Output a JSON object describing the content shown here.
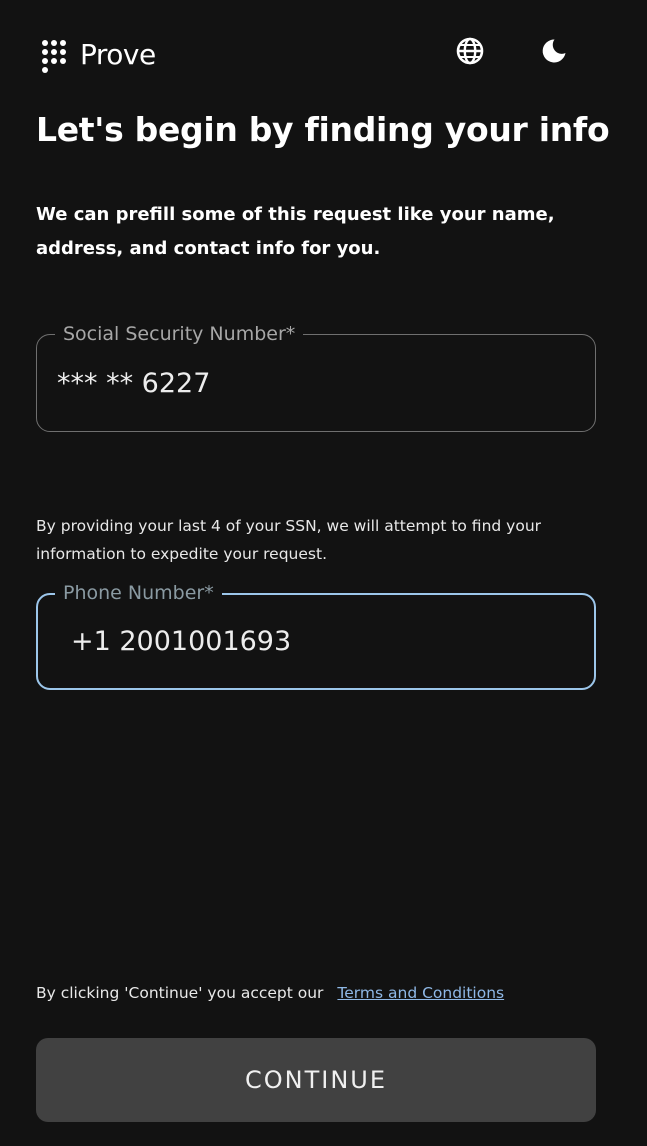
{
  "header": {
    "brand": "Prove",
    "logo_icon": "prove-dot-grid-logo",
    "language_icon": "globe-icon",
    "theme_icon": "moon-icon"
  },
  "main": {
    "title": "Let's begin by finding your info",
    "intro": "We can prefill some of this request like your name, address, and contact info for you.",
    "ssn": {
      "label": "Social Security Number*",
      "value": "*** ** 6227"
    },
    "helper": "By providing your last 4 of your SSN, we will attempt to find your information to expedite your request.",
    "phone": {
      "label": "Phone Number*",
      "value": "+1 2001001693"
    }
  },
  "footer": {
    "terms_prefix": "By clicking 'Continue' you accept our",
    "terms_link": "Terms and Conditions",
    "continue_label": "CONTINUE"
  },
  "colors": {
    "background": "#121212",
    "focus_border": "#9cc6ea",
    "link": "#8fb8e6",
    "button": "#414141"
  }
}
